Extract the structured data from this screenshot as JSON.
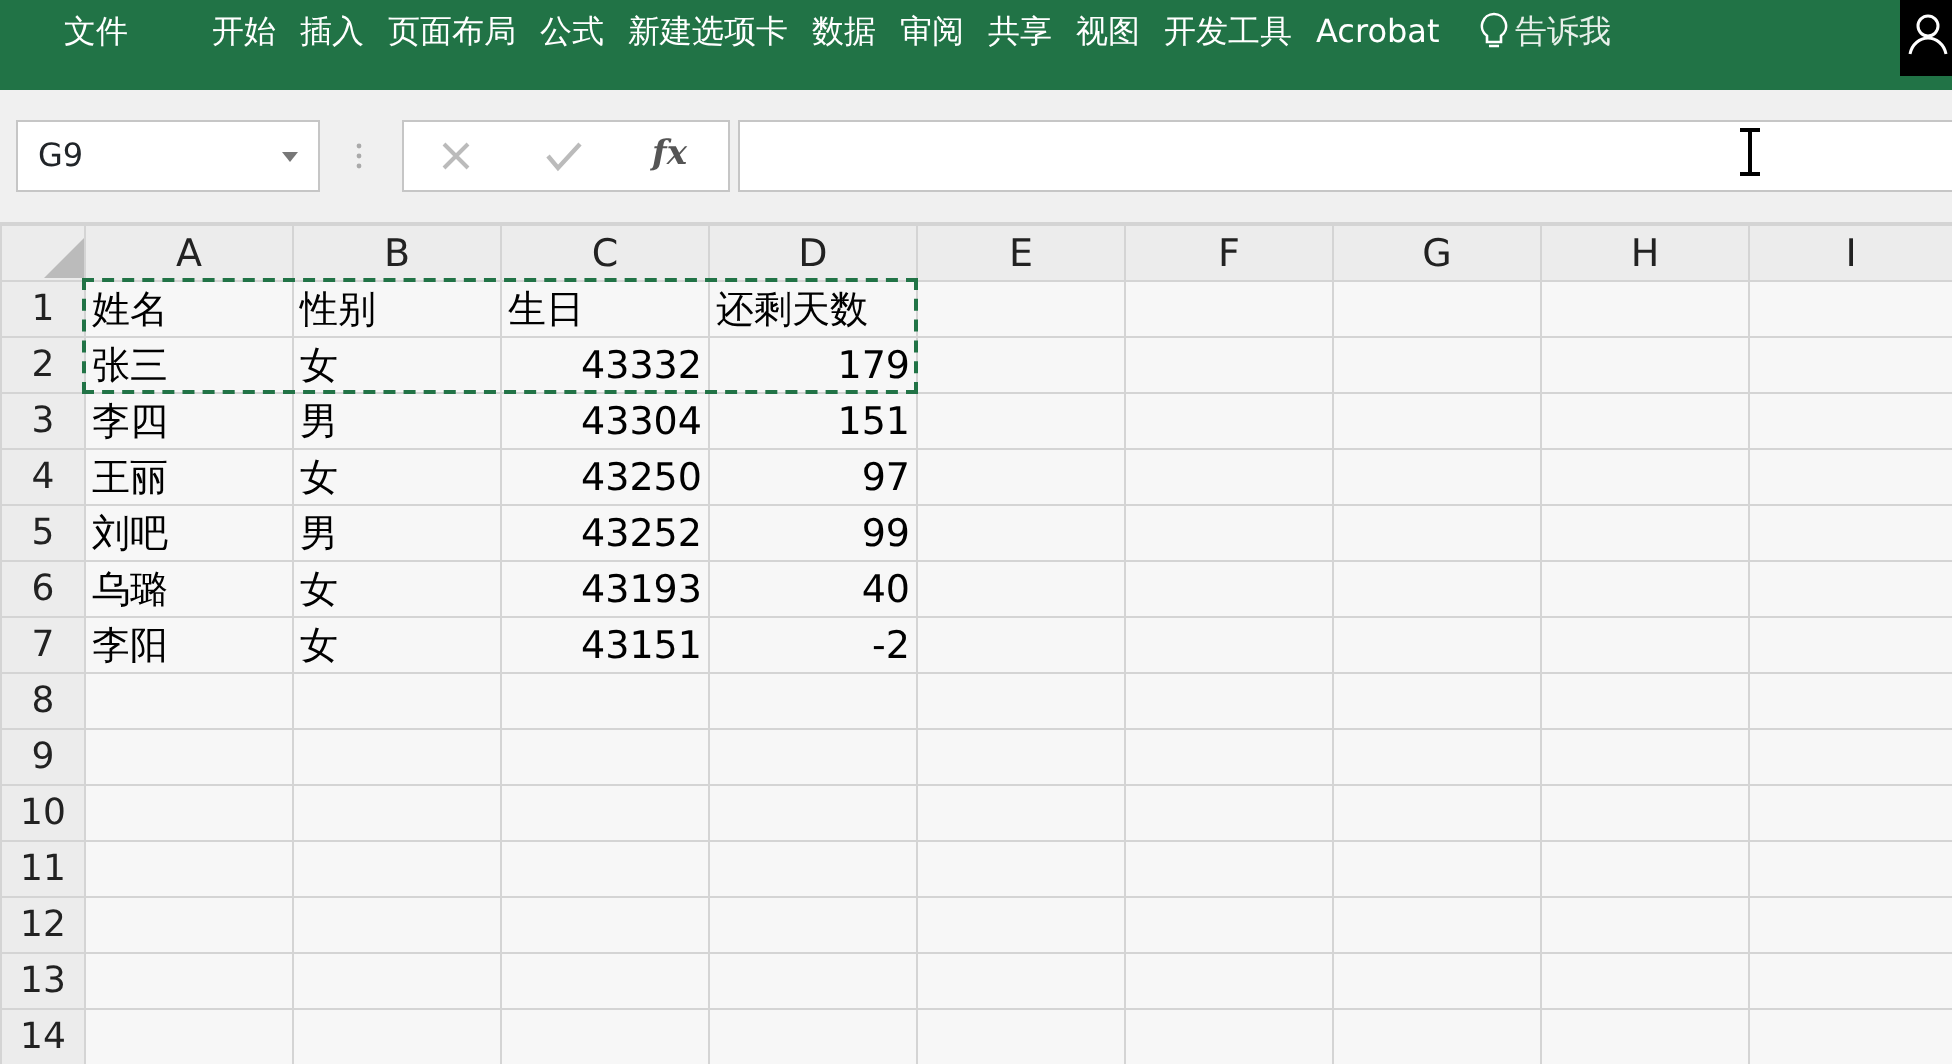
{
  "ribbon": {
    "tabs": [
      {
        "label": "文件"
      },
      {
        "label": "开始"
      },
      {
        "label": "插入"
      },
      {
        "label": "页面布局"
      },
      {
        "label": "公式"
      },
      {
        "label": "新建选项卡"
      },
      {
        "label": "数据"
      },
      {
        "label": "审阅"
      },
      {
        "label": "共享"
      },
      {
        "label": "视图"
      },
      {
        "label": "开发工具"
      },
      {
        "label": "Acrobat"
      }
    ],
    "tell_me": "告诉我"
  },
  "formula_bar": {
    "name_box": "G9",
    "fx": "fx"
  },
  "sheet": {
    "columns": [
      "A",
      "B",
      "C",
      "D",
      "E",
      "F",
      "G",
      "H",
      "I"
    ],
    "rows": [
      {
        "number": "1",
        "copied": true,
        "cells": [
          {
            "text": "姓名",
            "kind": "text"
          },
          {
            "text": "性别",
            "kind": "text"
          },
          {
            "text": "生日",
            "kind": "text"
          },
          {
            "text": "还剩天数",
            "kind": "text"
          }
        ]
      },
      {
        "number": "2",
        "copied": true,
        "cells": [
          {
            "text": "张三",
            "kind": "text"
          },
          {
            "text": "女",
            "kind": "text"
          },
          {
            "text": "43332",
            "kind": "number"
          },
          {
            "text": "179",
            "kind": "number"
          }
        ]
      },
      {
        "number": "3",
        "copied": false,
        "cells": [
          {
            "text": "李四",
            "kind": "text"
          },
          {
            "text": "男",
            "kind": "text"
          },
          {
            "text": "43304",
            "kind": "number"
          },
          {
            "text": "151",
            "kind": "number"
          }
        ]
      },
      {
        "number": "4",
        "copied": false,
        "cells": [
          {
            "text": "王丽",
            "kind": "text"
          },
          {
            "text": "女",
            "kind": "text"
          },
          {
            "text": "43250",
            "kind": "number"
          },
          {
            "text": "97",
            "kind": "number"
          }
        ]
      },
      {
        "number": "5",
        "copied": false,
        "cells": [
          {
            "text": "刘吧",
            "kind": "text"
          },
          {
            "text": "男",
            "kind": "text"
          },
          {
            "text": "43252",
            "kind": "number"
          },
          {
            "text": "99",
            "kind": "number"
          }
        ]
      },
      {
        "number": "6",
        "copied": false,
        "cells": [
          {
            "text": "乌璐",
            "kind": "text"
          },
          {
            "text": "女",
            "kind": "text"
          },
          {
            "text": "43193",
            "kind": "number"
          },
          {
            "text": "40",
            "kind": "number"
          }
        ]
      },
      {
        "number": "7",
        "copied": false,
        "cells": [
          {
            "text": "李阳",
            "kind": "text"
          },
          {
            "text": "女",
            "kind": "text"
          },
          {
            "text": "43151",
            "kind": "number"
          },
          {
            "text": "-2",
            "kind": "number"
          }
        ]
      },
      {
        "number": "8",
        "copied": false,
        "cells": []
      },
      {
        "number": "9",
        "copied": false,
        "cells": []
      },
      {
        "number": "10",
        "copied": false,
        "cells": []
      },
      {
        "number": "11",
        "copied": false,
        "cells": []
      },
      {
        "number": "12",
        "copied": false,
        "cells": []
      },
      {
        "number": "13",
        "copied": false,
        "cells": []
      },
      {
        "number": "14",
        "copied": false,
        "cells": []
      }
    ]
  }
}
